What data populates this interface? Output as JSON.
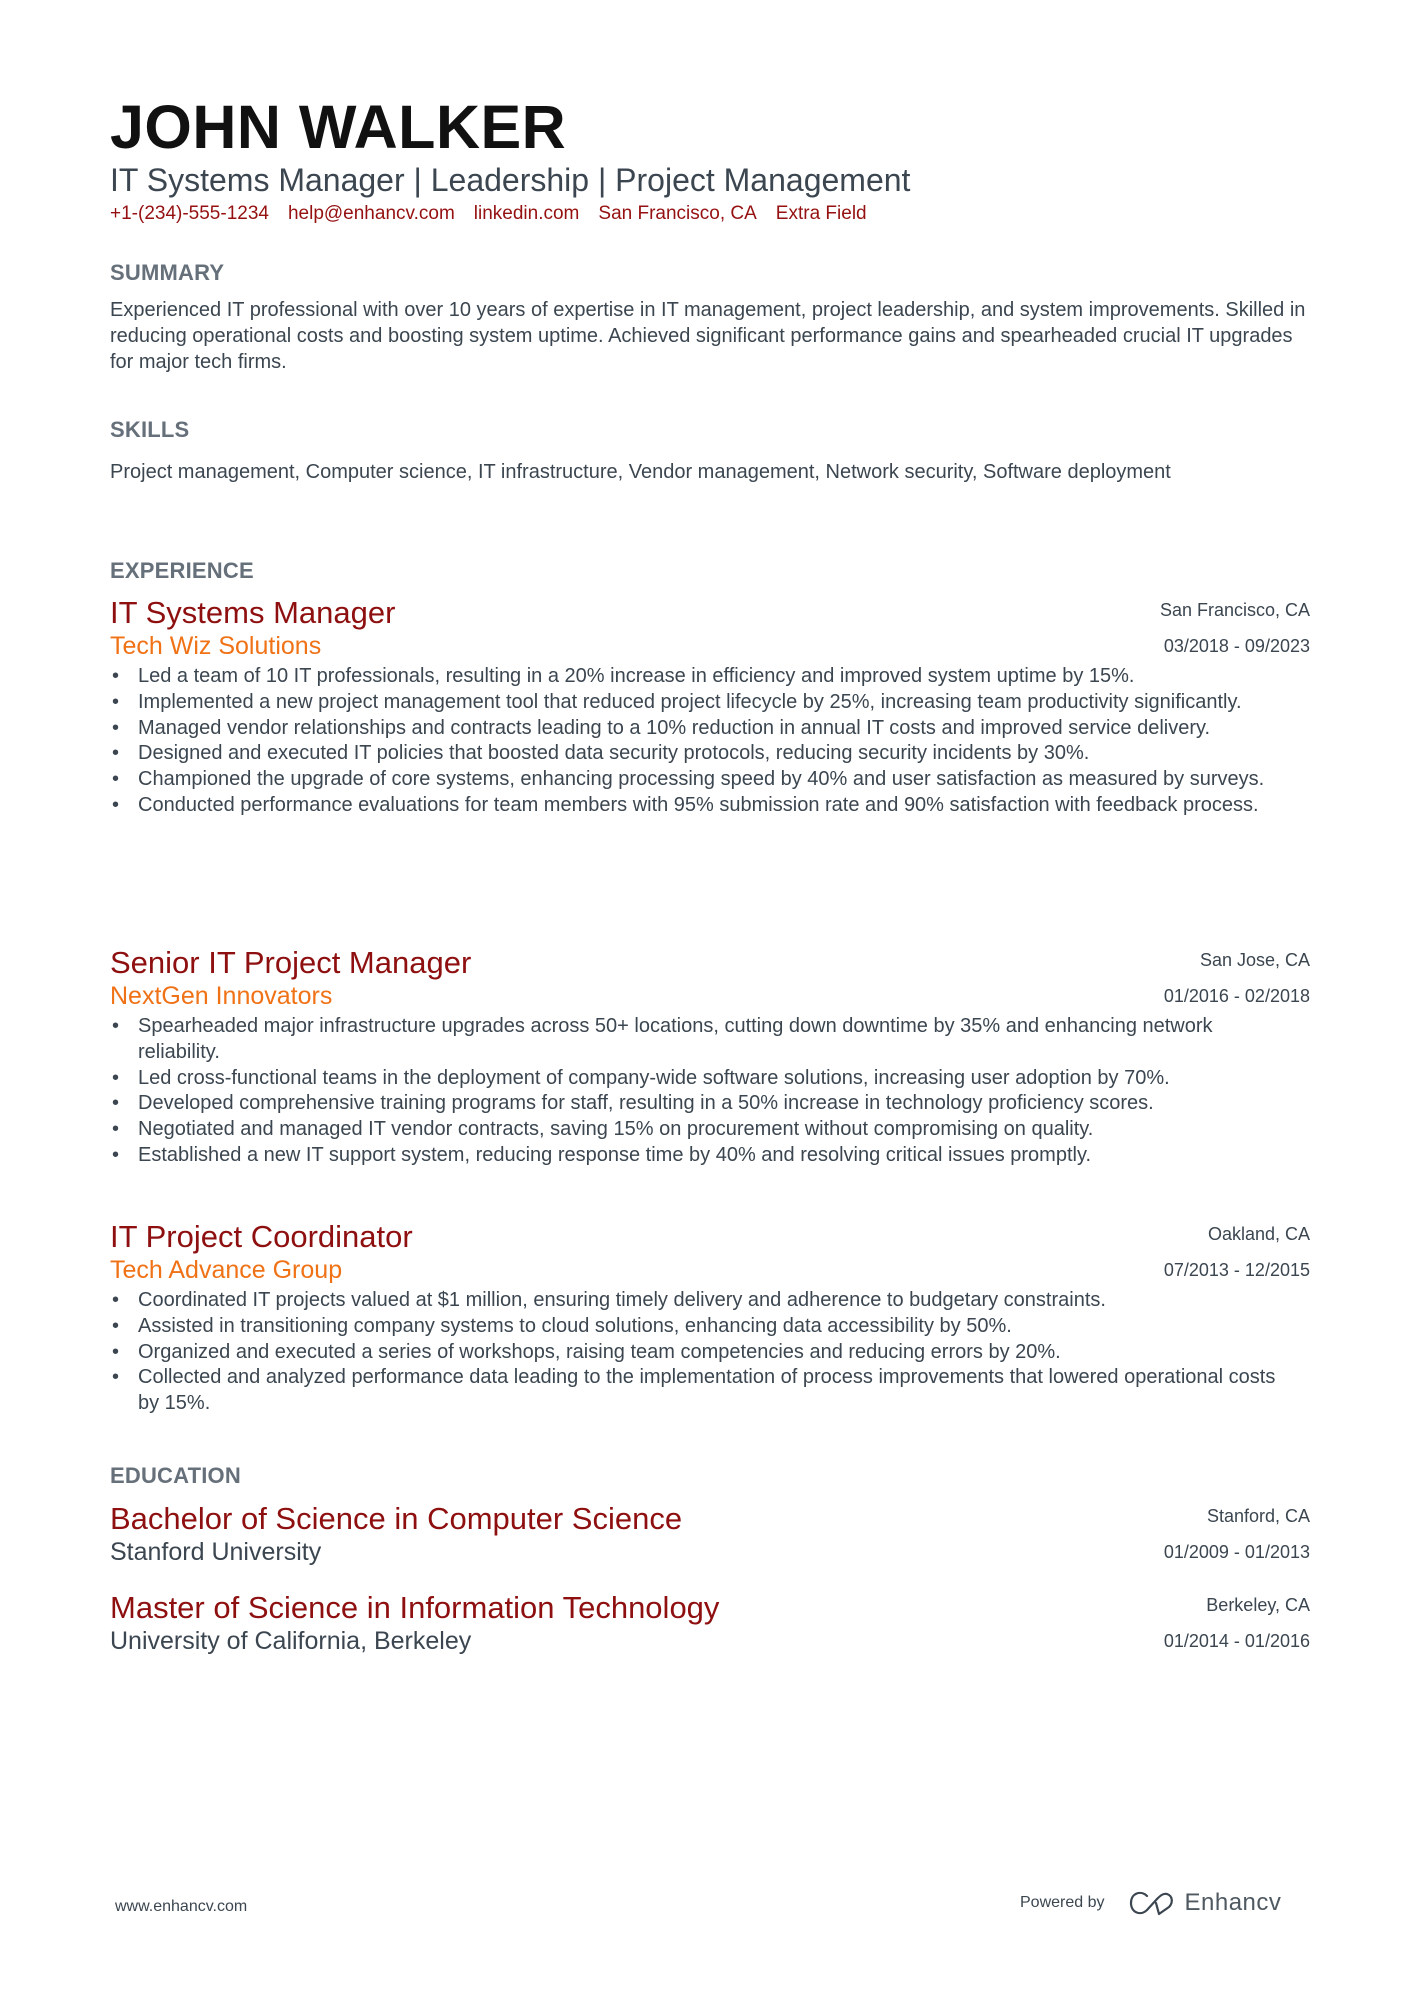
{
  "header": {
    "name": "JOHN WALKER",
    "tagline": "IT Systems Manager | Leadership | Project Management",
    "contacts": [
      "+1-(234)-555-1234",
      "help@enhancv.com",
      "linkedin.com",
      "San Francisco, CA",
      "Extra Field"
    ]
  },
  "colors": {
    "name": "#111111",
    "accent_title": "#8e0f0f",
    "accent_company": "#f07216",
    "contact": "#951111",
    "section_heading": "#66707a",
    "body_text": "#3b4650"
  },
  "summary": {
    "heading": "SUMMARY",
    "text": "Experienced IT professional with over 10 years of expertise in IT management, project leadership, and system improvements. Skilled in reducing operational costs and boosting system uptime. Achieved significant performance gains and spearheaded crucial IT upgrades for major tech firms."
  },
  "skills": {
    "heading": "SKILLS",
    "text": "Project management, Computer science, IT infrastructure, Vendor management, Network security, Software deployment"
  },
  "experience": {
    "heading": "EXPERIENCE",
    "jobs": [
      {
        "title": "IT Systems Manager",
        "company": "Tech Wiz Solutions",
        "location": "San Francisco, CA",
        "dates": "03/2018 - 09/2023",
        "bullets": [
          "Led a team of 10 IT professionals, resulting in a 20% increase in efficiency and improved system uptime by 15%.",
          "Implemented a new project management tool that reduced project lifecycle by 25%, increasing team productivity significantly.",
          "Managed vendor relationships and contracts leading to a 10% reduction in annual IT costs and improved service delivery.",
          "Designed and executed IT policies that boosted data security protocols, reducing security incidents by 30%.",
          "Championed the upgrade of core systems, enhancing processing speed by 40% and user satisfaction as measured by surveys.",
          "Conducted performance evaluations for team members with 95% submission rate and 90% satisfaction with feedback process."
        ]
      },
      {
        "title": "Senior IT Project Manager",
        "company": "NextGen Innovators",
        "location": "San Jose, CA",
        "dates": "01/2016 - 02/2018",
        "bullets": [
          "Spearheaded major infrastructure upgrades across 50+ locations, cutting down downtime by 35% and enhancing network reliability.",
          "Led cross-functional teams in the deployment of company-wide software solutions, increasing user adoption by 70%.",
          "Developed comprehensive training programs for staff, resulting in a 50% increase in technology proficiency scores.",
          "Negotiated and managed IT vendor contracts, saving 15% on procurement without compromising on quality.",
          "Established a new IT support system, reducing response time by 40% and resolving critical issues promptly."
        ]
      },
      {
        "title": "IT Project Coordinator",
        "company": "Tech Advance Group",
        "location": "Oakland, CA",
        "dates": "07/2013 - 12/2015",
        "bullets": [
          "Coordinated IT projects valued at $1 million, ensuring timely delivery and adherence to budgetary constraints.",
          "Assisted in transitioning company systems to cloud solutions, enhancing data accessibility by 50%.",
          "Organized and executed a series of workshops, raising team competencies and reducing errors by 20%.",
          "Collected and analyzed performance data leading to the implementation of process improvements that lowered operational costs by 15%."
        ]
      }
    ]
  },
  "education": {
    "heading": "EDUCATION",
    "items": [
      {
        "degree": "Bachelor of Science in Computer Science",
        "school": "Stanford University",
        "location": "Stanford, CA",
        "dates": "01/2009 - 01/2013"
      },
      {
        "degree": "Master of Science in Information Technology",
        "school": "University of California, Berkeley",
        "location": "Berkeley, CA",
        "dates": "01/2014 - 01/2016"
      }
    ]
  },
  "footer": {
    "website": "www.enhancv.com",
    "powered_by": "Powered by",
    "brand": "Enhancv",
    "brand_icon": "enhancv-logo-icon"
  }
}
